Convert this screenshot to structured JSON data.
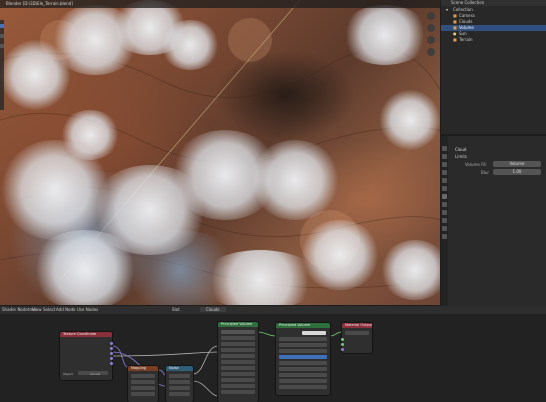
{
  "viewport": {
    "title": "Blender [D:\\3D\\Ele_Terrain.blend]"
  },
  "outliner": {
    "title": "Scene Collection",
    "items": [
      {
        "label": "Collection",
        "selected": false
      },
      {
        "label": "Camera",
        "selected": false
      },
      {
        "label": "Clouds",
        "selected": false
      },
      {
        "label": "Volume",
        "selected": true
      },
      {
        "label": "Sun",
        "selected": false
      },
      {
        "label": "Terrain",
        "selected": false
      }
    ]
  },
  "properties": {
    "object_name": "Cloud",
    "section": "Limits",
    "fields": [
      {
        "label": "Volume Fill",
        "value": "Volume"
      },
      {
        "label": "Blur",
        "value": "1.00"
      }
    ]
  },
  "shader_editor": {
    "title": "Shader Nodetree",
    "menus": [
      "View",
      "Select",
      "Add",
      "Node",
      "Use Nodes"
    ],
    "slot": "Slot",
    "material": "Clouds",
    "nodes": [
      {
        "title": "Texture Coordinate",
        "color": "#8b2f3a"
      },
      {
        "title": "Mapping",
        "color": "#6e3a2a"
      },
      {
        "title": "Noise",
        "color": "#2f5f78"
      },
      {
        "title": "Principled Volume",
        "color": "#2e6f3c"
      },
      {
        "title": "Principled Volume",
        "color": "#2e6f3c"
      },
      {
        "title": "Material Output",
        "color": "#8b2f3a"
      }
    ],
    "bottom_labels": [
      "Object",
      "Clouds"
    ]
  }
}
